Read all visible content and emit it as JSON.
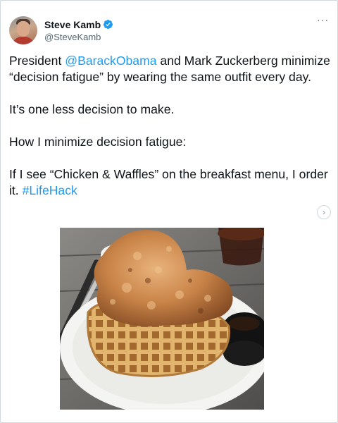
{
  "author": {
    "name": "Steve Kamb",
    "handle": "@SteveKamb",
    "verified": true
  },
  "menu": {
    "more_label": "···"
  },
  "tweet": {
    "line1_prefix": "President ",
    "mention": "@BarackObama",
    "line1_suffix": " and Mark Zuckerberg minimize “decision fatigue” by wearing the same outfit every day.",
    "line2": "It’s one less decision to make.",
    "line3": "How I minimize decision fatigue:",
    "line4_prefix": "If I see “Chicken & Waffles” on the breakfast menu, I order it. ",
    "hashtag": "#LifeHack"
  },
  "carousel": {
    "next_icon": "chevron-right-icon",
    "next_glyph": "›"
  },
  "colors": {
    "link": "#1d9bf0",
    "verified": "#1d9bf0",
    "text": "#0f1419",
    "secondary": "#536471"
  },
  "media": {
    "icon": "chicken-and-waffles-photo"
  }
}
